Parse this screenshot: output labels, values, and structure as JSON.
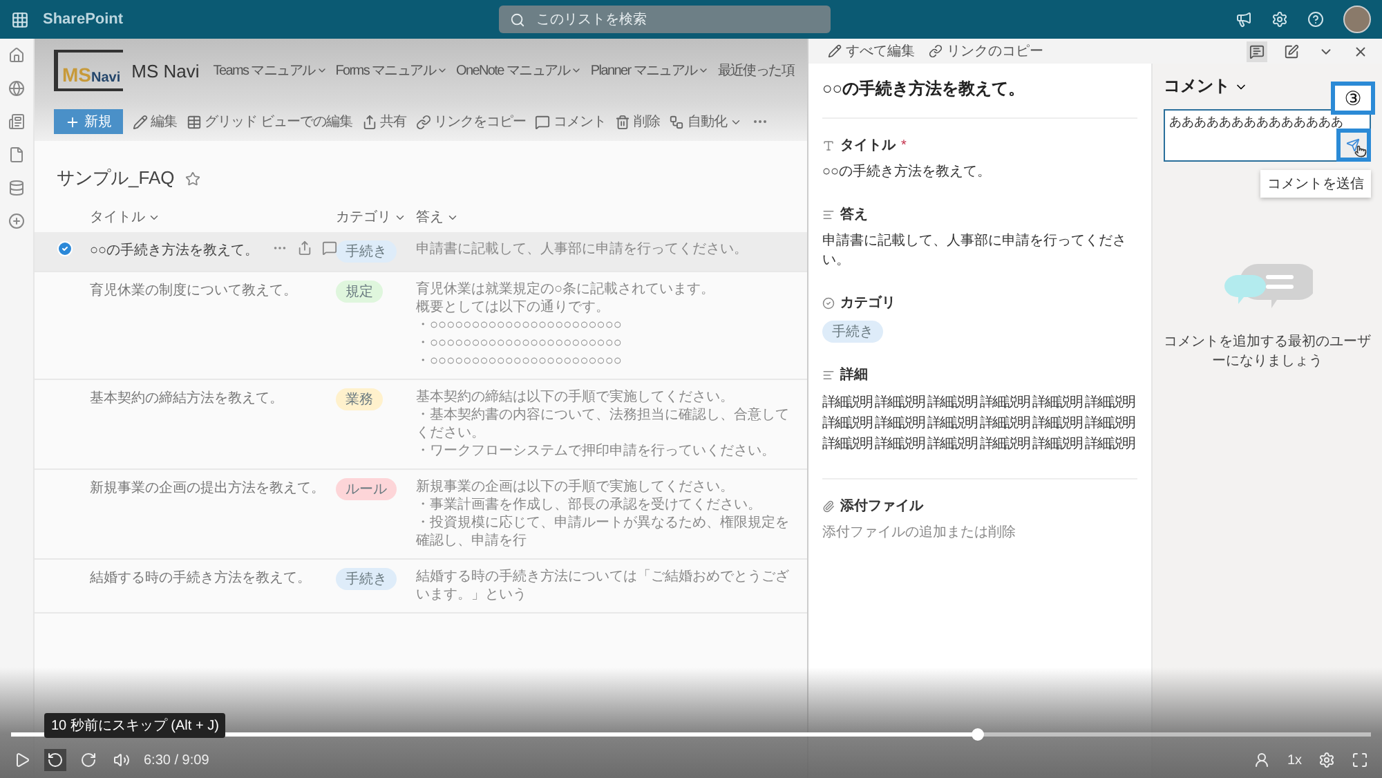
{
  "top_bar": {
    "app_name": "SharePoint",
    "search": {
      "placeholder": "このリストを検索"
    }
  },
  "site": {
    "logo": [
      "MS",
      "Navi"
    ],
    "name": "MS Navi",
    "nav": [
      {
        "label": "Teams マニュアル"
      },
      {
        "label": "Forms マニュアル"
      },
      {
        "label": "OneNote マニュアル"
      },
      {
        "label": "Planner マニュアル"
      },
      {
        "label": "最近使った項"
      }
    ]
  },
  "command_bar": {
    "new_button": "新規",
    "commands": [
      {
        "label": "編集"
      },
      {
        "label": "グリッド ビューでの編集"
      },
      {
        "label": "共有"
      },
      {
        "label": "リンクをコピー"
      },
      {
        "label": "コメント"
      },
      {
        "label": "削除"
      },
      {
        "label": "自動化",
        "kind": "menu"
      }
    ]
  },
  "list": {
    "title": "サンプル_FAQ",
    "columns": [
      "タイトル",
      "カテゴリ",
      "答え"
    ],
    "rows": [
      {
        "title": "○○の手続き方法を教えて。",
        "category": {
          "label": "手続き",
          "color": "#deecf9"
        },
        "answer": [
          "申請書に記載して、人事部に申請を行ってください。"
        ],
        "selected": true
      },
      {
        "title": "育児休業の制度について教えて。",
        "category": {
          "label": "規定",
          "color": "#dff6dd"
        },
        "answer": [
          "育児休業は就業規定の○条に記載されています。",
          "概要としては以下の通りです。",
          "・○○○○○○○○○○○○○○○○○○○○○○○",
          "・○○○○○○○○○○○○○○○○○○○○○○○",
          "・○○○○○○○○○○○○○○○○○○○○○○○"
        ],
        "selected": false
      },
      {
        "title": "基本契約の締結方法を教えて。",
        "category": {
          "label": "業務",
          "color": "#fff1cc"
        },
        "answer": [
          "基本契約の締結は以下の手順で実施してください。",
          "・基本契約書の内容について、法務担当に確認し、合意してください。",
          "・ワークフローシステムで押印申請を行っていください。"
        ],
        "selected": false
      },
      {
        "title": "新規事業の企画の提出方法を教えて。",
        "category": {
          "label": "ルール",
          "color": "#fdd5d8"
        },
        "answer": [
          "新規事業の企画は以下の手順で実施してください。",
          "・事業計画書を作成し、部長の承認を受けてください。",
          "・投資規模に応じて、申請ルートが異なるため、権限規定を確認し、申請を行"
        ],
        "selected": false
      },
      {
        "title": "結婚する時の手続き方法を教えて。",
        "category": {
          "label": "手続き",
          "color": "#deecf9"
        },
        "answer": [
          "結婚する時の手続き方法については「ご結婚おめでとうございます。」という"
        ],
        "selected": false
      }
    ]
  },
  "detail": {
    "toolbar": [
      "すべて編集",
      "リンクのコピー"
    ],
    "title": "○○の手続き方法を教えて。",
    "fields": [
      {
        "kind": "text",
        "label": "タイトル",
        "required_mark": "*",
        "value": "○○の手続き方法を教えて。"
      },
      {
        "kind": "text",
        "label": "答え",
        "value": "申請書に記載して、人事部に申請を行ってください。"
      },
      {
        "kind": "choice",
        "label": "カテゴリ",
        "value": "手続き",
        "color": "#deecf9"
      },
      {
        "kind": "grid",
        "label": "詳細",
        "values": [
          "詳細説明",
          "詳細説明",
          "詳細説明",
          "詳細説明",
          "詳細説明",
          "詳細説明",
          "詳細説明",
          "詳細説明",
          "詳細説明",
          "詳細説明",
          "詳細説明",
          "詳細説明",
          "詳細説明",
          "詳細説明",
          "詳細説明",
          "詳細説明",
          "詳細説明",
          "詳細説明"
        ]
      },
      {
        "kind": "attachment",
        "label": "添付ファイル",
        "value": "添付ファイルの追加または削除"
      }
    ]
  },
  "comments": {
    "title": "コメント",
    "draft": "ああああああああああああああ",
    "send_tooltip": "コメントを送信",
    "empty_message": "コメントを追加する最初のユーザーになりましょう"
  },
  "annotation": {
    "label": "③"
  },
  "player": {
    "tooltip": "10 秒前にスキップ (Alt + J)",
    "time": "6:30 / 9:09",
    "speed": "1x",
    "level": 0.71
  }
}
